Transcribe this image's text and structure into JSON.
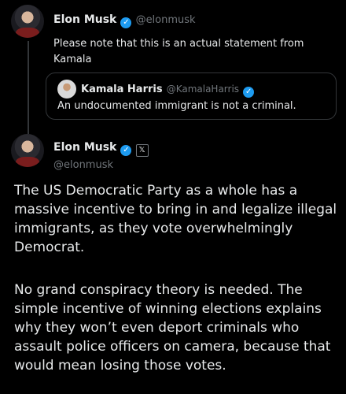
{
  "tweet1": {
    "name": "Elon Musk",
    "handle": "@elonmusk",
    "text": "Please note that this is an actual statement from Kamala"
  },
  "quote": {
    "name": "Kamala Harris",
    "handle": "@KamalaHarris",
    "text": "An undocumented immigrant is not a criminal."
  },
  "tweet2": {
    "name": "Elon Musk",
    "handle": "@elonmusk",
    "paragraphs": [
      "The US Democratic Party as a whole has a massive incentive to bring in and legalize illegal immigrants, as they vote overwhelmingly Democrat.",
      "No grand conspiracy theory is needed. The simple incentive of winning elections explains why they won’t even deport criminals who assault police officers on camera, because that would mean losing those votes."
    ]
  },
  "icons": {
    "verified": "verified-badge-icon",
    "x_affiliation": "x-logo-icon"
  },
  "colors": {
    "background": "#000000",
    "text": "#e7e9ea",
    "muted": "#71767b",
    "verified": "#1d9bf0"
  }
}
